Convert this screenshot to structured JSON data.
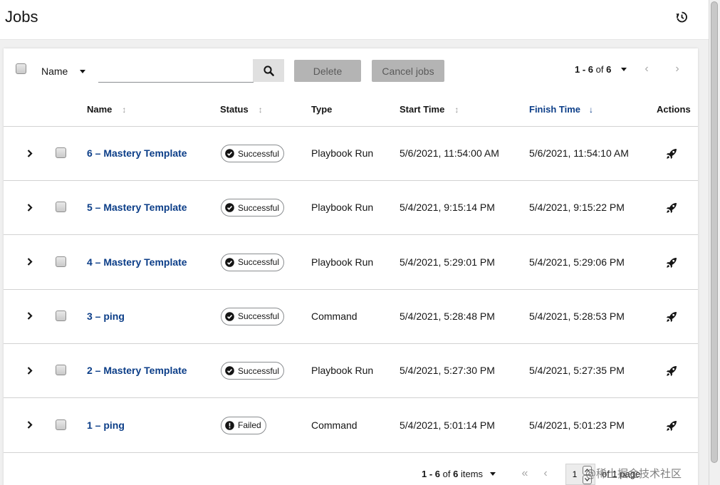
{
  "header": {
    "title": "Jobs",
    "history_icon": "history-icon"
  },
  "toolbar": {
    "filter_label": "Name",
    "search_placeholder": "",
    "search_value": "",
    "delete_label": "Delete",
    "cancel_label": "Cancel jobs",
    "pagination": {
      "range": "1 - 6",
      "of_word": "of",
      "total": "6"
    }
  },
  "table": {
    "columns": {
      "name": "Name",
      "status": "Status",
      "type": "Type",
      "start_time": "Start Time",
      "finish_time": "Finish Time",
      "actions": "Actions"
    },
    "sorted_column": "finish_time",
    "sort_direction": "descending",
    "rows": [
      {
        "name": "6 – Mastery Template",
        "status": "Successful",
        "type": "Playbook Run",
        "start": "5/6/2021, 11:54:00 AM",
        "finish": "5/6/2021, 11:54:10 AM"
      },
      {
        "name": "5 – Mastery Template",
        "status": "Successful",
        "type": "Playbook Run",
        "start": "5/4/2021, 9:15:14 PM",
        "finish": "5/4/2021, 9:15:22 PM"
      },
      {
        "name": "4 – Mastery Template",
        "status": "Successful",
        "type": "Playbook Run",
        "start": "5/4/2021, 5:29:01 PM",
        "finish": "5/4/2021, 5:29:06 PM"
      },
      {
        "name": "3 – ping",
        "status": "Successful",
        "type": "Command",
        "start": "5/4/2021, 5:28:48 PM",
        "finish": "5/4/2021, 5:28:53 PM"
      },
      {
        "name": "2 – Mastery Template",
        "status": "Successful",
        "type": "Playbook Run",
        "start": "5/4/2021, 5:27:30 PM",
        "finish": "5/4/2021, 5:27:35 PM"
      },
      {
        "name": "1 – ping",
        "status": "Failed",
        "type": "Command",
        "start": "5/4/2021, 5:01:14 PM",
        "finish": "5/4/2021, 5:01:23 PM"
      }
    ]
  },
  "footer": {
    "range": "1 - 6",
    "of_word": "of",
    "total": "6",
    "items_word": "items",
    "page": "1",
    "of_page": "of 1 page"
  },
  "watermark": "@稀土掘金技术社区",
  "colors": {
    "link": "#0c3e88",
    "success": "#151515",
    "failed": "#151515",
    "disabled_button": "#b4b4b4"
  }
}
